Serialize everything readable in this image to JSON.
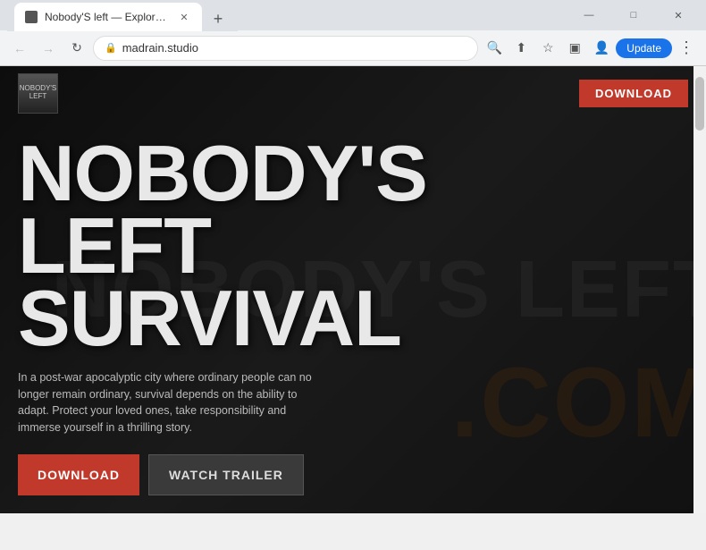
{
  "browser": {
    "title": "Nobody'S left — Explore, Build ...",
    "tab_label": "Nobody'S left — Explore, Build ...",
    "url": "madrain.studio",
    "back_btn": "←",
    "forward_btn": "→",
    "reload_btn": "↻",
    "new_tab_btn": "+",
    "update_label": "Update",
    "window_minimize": "—",
    "window_maximize": "□",
    "window_close": "✕"
  },
  "nav": {
    "download_label": "DOWNLOAD"
  },
  "hero": {
    "title_line1": "NOBODY'S",
    "title_line2": "LEFT",
    "title_line3": "SURVIVAL",
    "watermark_text": "NOBODY'S LEFT",
    "watermark_com": ".COM",
    "description": "In a post-war apocalyptic city where ordinary people can no longer remain ordinary, survival depends on the ability to adapt. Protect your loved ones, take responsibility and immerse yourself in a thrilling story.",
    "btn_download": "DOWNLOAD",
    "btn_trailer": "WATCH TRAILER"
  },
  "colors": {
    "accent_red": "#c0392b",
    "bg_dark": "#0d0d0d",
    "text_light": "#e8e8e8",
    "text_muted": "#bbb"
  }
}
